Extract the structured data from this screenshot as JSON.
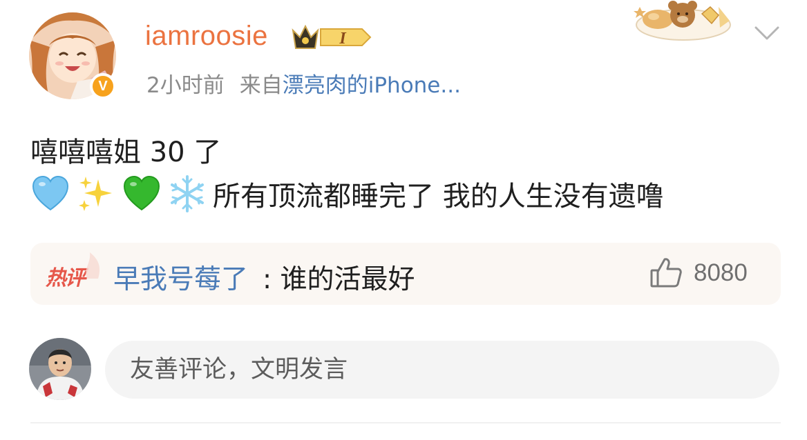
{
  "post": {
    "author": {
      "username": "iamroosie",
      "verified_badge": "V",
      "vip_level": "I"
    },
    "time": "2小时前",
    "source_prefix": "来自",
    "source_name": "漂亮肉的iPhone...",
    "text_line1": "嘻嘻嘻姐 30 了",
    "emojis": [
      "blue-heart",
      "sparkles",
      "green-heart",
      "snowflake"
    ],
    "text_line2": "所有顶流都睡完了 我的人生没有遗噜"
  },
  "hot_comment": {
    "tag": "热评",
    "author": "早我号莓了",
    "text": ": 谁的活最好",
    "likes": "8080"
  },
  "composer": {
    "placeholder": "友善评论，文明发言"
  },
  "colors": {
    "username": "#eb7340",
    "link": "#4a7bb7",
    "hot_tag": "#e6574a",
    "text": "#1f1f1f",
    "meta": "#8a8a8a",
    "verified": "#f7a21d"
  },
  "icons": [
    "verified-badge-icon",
    "crown-vip-icon",
    "more-chevron-icon",
    "like-thumb-icon"
  ]
}
